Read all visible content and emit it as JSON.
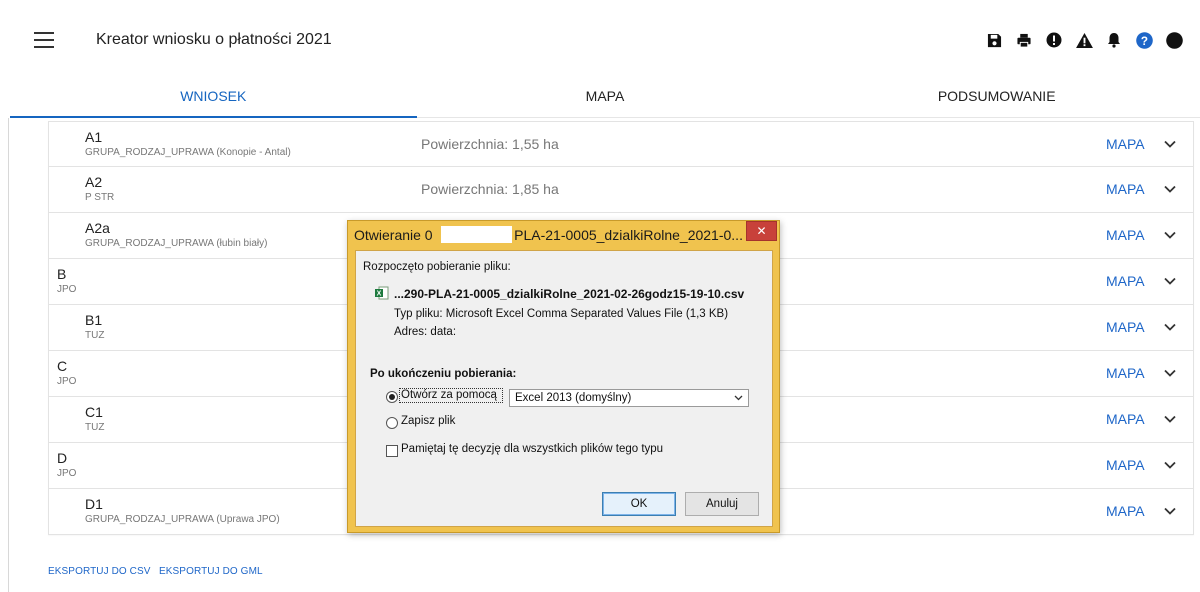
{
  "header": {
    "menu_icon": "hamburger-menu-icon",
    "title": "Kreator wniosku o płatności 2021",
    "actions": [
      "save-icon",
      "print-icon",
      "alert-circle-icon",
      "warning-icon",
      "bell-icon",
      "help-icon"
    ]
  },
  "tabs": [
    {
      "label": "WNIOSEK",
      "active": true
    },
    {
      "label": "MAPA",
      "active": false
    },
    {
      "label": "PODSUMOWANIE",
      "active": false
    }
  ],
  "rows": [
    {
      "name": "A1",
      "sub": "GRUPA_RODZAJ_UPRAWA (Konopie - Antal)",
      "area": "Powierzchnia: 1,55 ha",
      "map": "MAPA"
    },
    {
      "name": "A2",
      "sub": "P STR",
      "area": "Powierzchnia: 1,85 ha",
      "map": "MAPA"
    },
    {
      "name": "A2a",
      "sub": "GRUPA_RODZAJ_UPRAWA (łubin biały)",
      "area": "",
      "map": "MAPA"
    },
    {
      "name": "B",
      "sub": "JPO",
      "area": "",
      "map": "MAPA"
    },
    {
      "name": "B1",
      "sub": "TUZ",
      "area": "",
      "map": "MAPA"
    },
    {
      "name": "C",
      "sub": "JPO",
      "area": "",
      "map": "MAPA"
    },
    {
      "name": "C1",
      "sub": "TUZ",
      "area": "",
      "map": "MAPA"
    },
    {
      "name": "D",
      "sub": "JPO",
      "area": "",
      "map": "MAPA"
    },
    {
      "name": "D1",
      "sub": "GRUPA_RODZAJ_UPRAWA (Uprawa JPO)",
      "area": "",
      "map": "MAPA"
    }
  ],
  "footer": {
    "export_csv": "EKSPORTUJ DO CSV",
    "export_gml": "EKSPORTUJ DO GML"
  },
  "dialog": {
    "title_prefix": "Otwieranie 0",
    "title_suffix": "- PLA-21-0005_dzialkiRolne_2021-0...",
    "close": "✕",
    "started": "Rozpoczęto pobieranie pliku:",
    "file_icon": "excel-file-icon",
    "file_name": "...290-PLA-21-0005_dzialkiRolne_2021-02-26godz15-19-10.csv",
    "file_type": "Typ pliku: Microsoft Excel Comma Separated Values File (1,3 KB)",
    "address": "Adres: data:",
    "after_label": "Po ukończeniu pobierania:",
    "open_with_label": "Otwórz za pomocą",
    "open_with_app": "Excel 2013 (domyślny)",
    "save_label": "Zapisz plik",
    "remember_label": "Pamiętaj tę decyzję dla wszystkich plików tego typu",
    "ok": "OK",
    "cancel": "Anuluj"
  }
}
